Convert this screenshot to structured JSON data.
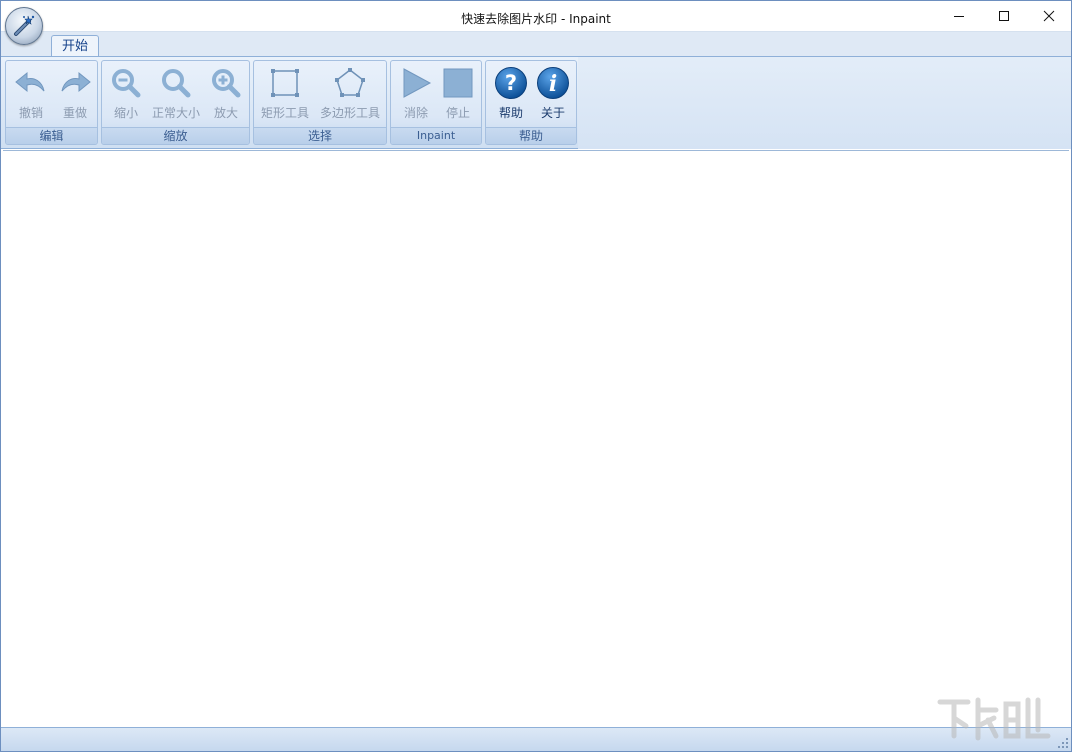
{
  "window": {
    "title": "快速去除图片水印 - Inpaint"
  },
  "tabs": [
    {
      "label": "开始"
    }
  ],
  "ribbon": {
    "groups": [
      {
        "label": "编辑",
        "buttons": [
          {
            "label": "撤销",
            "icon": "undo-icon"
          },
          {
            "label": "重做",
            "icon": "redo-icon"
          }
        ]
      },
      {
        "label": "缩放",
        "buttons": [
          {
            "label": "缩小",
            "icon": "zoom-out-icon"
          },
          {
            "label": "正常大小",
            "icon": "zoom-normal-icon"
          },
          {
            "label": "放大",
            "icon": "zoom-in-icon"
          }
        ]
      },
      {
        "label": "选择",
        "buttons": [
          {
            "label": "矩形工具",
            "icon": "rectangle-tool-icon"
          },
          {
            "label": "多边形工具",
            "icon": "polygon-tool-icon"
          }
        ]
      },
      {
        "label": "Inpaint",
        "buttons": [
          {
            "label": "消除",
            "icon": "play-icon"
          },
          {
            "label": "停止",
            "icon": "stop-icon"
          }
        ]
      },
      {
        "label": "帮助",
        "buttons": [
          {
            "label": "帮助",
            "icon": "help-icon"
          },
          {
            "label": "关于",
            "icon": "info-icon"
          }
        ]
      }
    ]
  },
  "colors": {
    "accent": "#1a66b0",
    "ribbon_bg": "#dce8f6",
    "disabled_icon": "#8fb3d6"
  }
}
